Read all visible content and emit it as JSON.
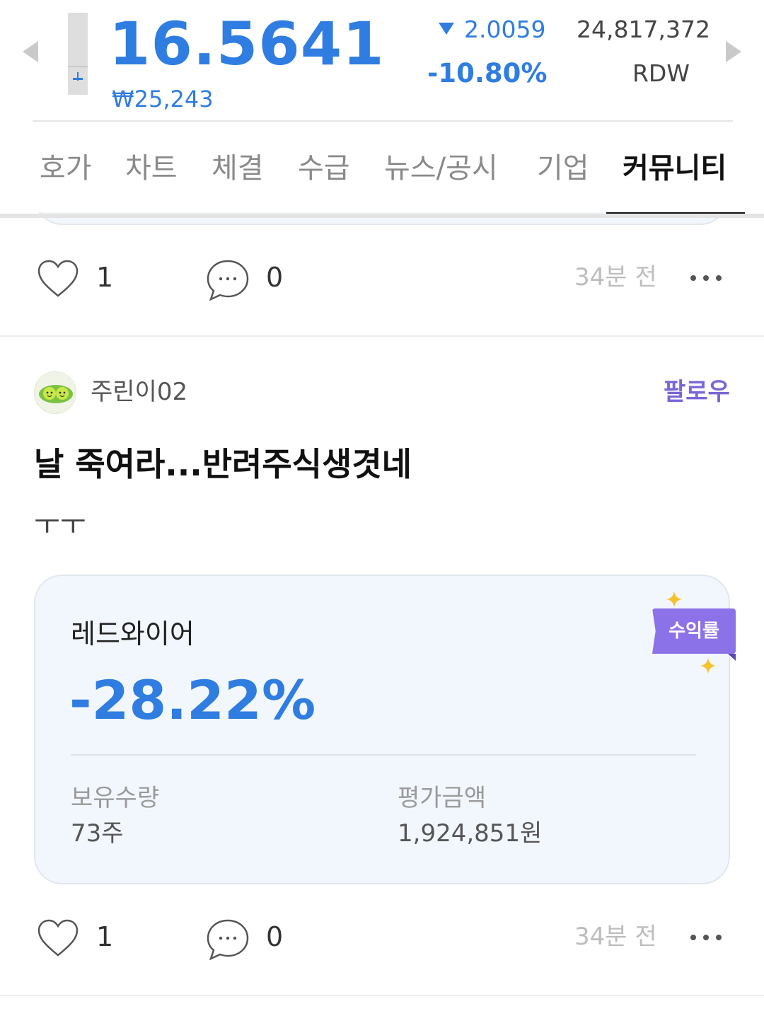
{
  "header": {
    "price": "16.5641",
    "krw_price": "₩25,243",
    "change": "2.0059",
    "change_pct": "-10.80%",
    "volume": "24,817,372",
    "ticker": "RDW",
    "price_color": "#2f7de1"
  },
  "tabs": [
    {
      "label": "호가"
    },
    {
      "label": "차트"
    },
    {
      "label": "체결"
    },
    {
      "label": "수급"
    },
    {
      "label": "뉴스/공시"
    },
    {
      "label": "기업"
    },
    {
      "label": "커뮤니티",
      "active": true
    }
  ],
  "prev_post": {
    "likes": "1",
    "comments": "0",
    "time": "34분 전"
  },
  "post": {
    "author": "주린이02",
    "follow_label": "팔로우",
    "title": "날 죽여라...반려주식생겻네",
    "body": "ㅜㅜ",
    "card": {
      "stock_name": "레드와이어",
      "return_pct": "-28.22%",
      "badge": "수익률",
      "holdings_label": "보유수량",
      "holdings_value": "73주",
      "valuation_label": "평가금액",
      "valuation_value": "1,924,851원"
    },
    "likes": "1",
    "comments": "0",
    "time": "34분 전"
  },
  "colors": {
    "accent_blue": "#2f7de1",
    "follow_purple": "#7b66d6",
    "badge_purple": "#8c72e8",
    "card_bg": "#f2f7fd"
  },
  "icons": [
    "prev-arrow-icon",
    "next-arrow-icon",
    "heart-icon",
    "comment-icon",
    "more-icon",
    "sparkle-icon"
  ]
}
